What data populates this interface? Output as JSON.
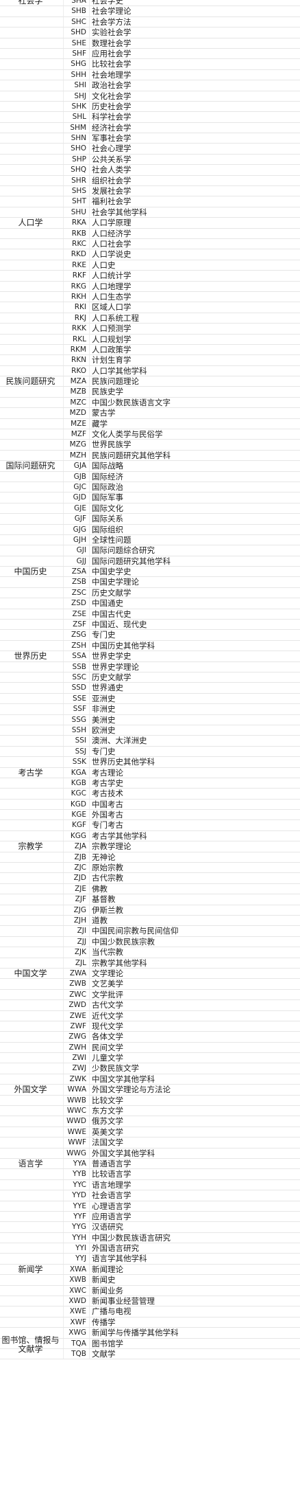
{
  "rows": [
    [
      "社会学",
      "SHA",
      "社会学史"
    ],
    [
      "",
      "SHB",
      "社会学理论"
    ],
    [
      "",
      "SHC",
      "社会学方法"
    ],
    [
      "",
      "SHD",
      "实验社会学"
    ],
    [
      "",
      "SHE",
      "数理社会学"
    ],
    [
      "",
      "SHF",
      "应用社会学"
    ],
    [
      "",
      "SHG",
      "比较社会学"
    ],
    [
      "",
      "SHH",
      "社会地理学"
    ],
    [
      "",
      "SHI",
      "政治社会学"
    ],
    [
      "",
      "SHJ",
      "文化社会学"
    ],
    [
      "",
      "SHK",
      "历史社会学"
    ],
    [
      "",
      "SHL",
      "科学社会学"
    ],
    [
      "",
      "SHM",
      "经济社会学"
    ],
    [
      "",
      "SHN",
      "军事社会学"
    ],
    [
      "",
      "SHO",
      "社会心理学"
    ],
    [
      "",
      "SHP",
      "公共关系学"
    ],
    [
      "",
      "SHQ",
      "社会人类学"
    ],
    [
      "",
      "SHR",
      "组织社会学"
    ],
    [
      "",
      "SHS",
      "发展社会学"
    ],
    [
      "",
      "SHT",
      "福利社会学"
    ],
    [
      "",
      "SHU",
      "社会学其他学科"
    ],
    [
      "人口学",
      "RKA",
      "人口学原理"
    ],
    [
      "",
      "RKB",
      "人口经济学"
    ],
    [
      "",
      "RKC",
      "人口社会学"
    ],
    [
      "",
      "RKD",
      "人口学说史"
    ],
    [
      "",
      "RKE",
      "人口史"
    ],
    [
      "",
      "RKF",
      "人口统计学"
    ],
    [
      "",
      "RKG",
      "人口地理学"
    ],
    [
      "",
      "RKH",
      "人口生态学"
    ],
    [
      "",
      "RKI",
      "区域人口学"
    ],
    [
      "",
      "RKJ",
      "人口系统工程"
    ],
    [
      "",
      "RKK",
      "人口预测学"
    ],
    [
      "",
      "RKL",
      "人口规划学"
    ],
    [
      "",
      "RKM",
      "人口政策学"
    ],
    [
      "",
      "RKN",
      "计划生育学"
    ],
    [
      "",
      "RKO",
      "人口学其他学科"
    ],
    [
      "民族问题研究",
      "MZA",
      "民族问题理论"
    ],
    [
      "",
      "MZB",
      "民族史学"
    ],
    [
      "",
      "MZC",
      "中国少数民族语言文字"
    ],
    [
      "",
      "MZD",
      "蒙古学"
    ],
    [
      "",
      "MZE",
      "藏学"
    ],
    [
      "",
      "MZF",
      "文化人类学与民俗学"
    ],
    [
      "",
      "MZG",
      "世界民族学"
    ],
    [
      "",
      "MZH",
      "民族问题研究其他学科"
    ],
    [
      "国际问题研究",
      "GJA",
      "国际战略"
    ],
    [
      "",
      "GJB",
      "国际经济"
    ],
    [
      "",
      "GJC",
      "国际政治"
    ],
    [
      "",
      "GJD",
      "国际军事"
    ],
    [
      "",
      "GJE",
      "国际文化"
    ],
    [
      "",
      "GJF",
      "国际关系"
    ],
    [
      "",
      "GJG",
      "国际组织"
    ],
    [
      "",
      "GJH",
      "全球性问题"
    ],
    [
      "",
      "GJI",
      "国际问题综合研究"
    ],
    [
      "",
      "GJJ",
      "国际问题研究其他学科"
    ],
    [
      "中国历史",
      "ZSA",
      "中国史学史"
    ],
    [
      "",
      "ZSB",
      "中国史学理论"
    ],
    [
      "",
      "ZSC",
      "历史文献学"
    ],
    [
      "",
      "ZSD",
      "中国通史"
    ],
    [
      "",
      "ZSE",
      "中国古代史"
    ],
    [
      "",
      "ZSF",
      "中国近、现代史"
    ],
    [
      "",
      "ZSG",
      "专门史"
    ],
    [
      "",
      "ZSH",
      "中国历史其他学科"
    ],
    [
      "世界历史",
      "SSA",
      "世界史学史"
    ],
    [
      "",
      "SSB",
      "世界史学理论"
    ],
    [
      "",
      "SSC",
      "历史文献学"
    ],
    [
      "",
      "SSD",
      "世界通史"
    ],
    [
      "",
      "SSE",
      "亚洲史"
    ],
    [
      "",
      "SSF",
      "非洲史"
    ],
    [
      "",
      "SSG",
      "美洲史"
    ],
    [
      "",
      "SSH",
      "欧洲史"
    ],
    [
      "",
      "SSI",
      "澳洲、大洋洲史"
    ],
    [
      "",
      "SSJ",
      "专门史"
    ],
    [
      "",
      "SSK",
      "世界历史其他学科"
    ],
    [
      "考古学",
      "KGA",
      "考古理论"
    ],
    [
      "",
      "KGB",
      "考古学史"
    ],
    [
      "",
      "KGC",
      "考古技术"
    ],
    [
      "",
      "KGD",
      "中国考古"
    ],
    [
      "",
      "KGE",
      "外国考古"
    ],
    [
      "",
      "KGF",
      "专门考古"
    ],
    [
      "",
      "KGG",
      "考古学其他学科"
    ],
    [
      "宗教学",
      "ZJA",
      "宗教学理论"
    ],
    [
      "",
      "ZJB",
      "无神论"
    ],
    [
      "",
      "ZJC",
      "原始宗教"
    ],
    [
      "",
      "ZJD",
      "古代宗教"
    ],
    [
      "",
      "ZJE",
      "佛教"
    ],
    [
      "",
      "ZJF",
      "基督教"
    ],
    [
      "",
      "ZJG",
      "伊斯兰教"
    ],
    [
      "",
      "ZJH",
      "道教"
    ],
    [
      "",
      "ZJI",
      "中国民间宗教与民间信仰"
    ],
    [
      "",
      "ZJJ",
      "中国少数民族宗教"
    ],
    [
      "",
      "ZJK",
      "当代宗教"
    ],
    [
      "",
      "ZJL",
      "宗教学其他学科"
    ],
    [
      "中国文学",
      "ZWA",
      "文学理论"
    ],
    [
      "",
      "ZWB",
      "文艺美学"
    ],
    [
      "",
      "ZWC",
      "文学批评"
    ],
    [
      "",
      "ZWD",
      "古代文学"
    ],
    [
      "",
      "ZWE",
      "近代文学"
    ],
    [
      "",
      "ZWF",
      "现代文学"
    ],
    [
      "",
      "ZWG",
      "各体文学"
    ],
    [
      "",
      "ZWH",
      "民间文学"
    ],
    [
      "",
      "ZWI",
      "儿童文学"
    ],
    [
      "",
      "ZWJ",
      "少数民族文学"
    ],
    [
      "",
      "ZWK",
      "中国文学其他学科"
    ],
    [
      "外国文学",
      "WWA",
      "外国文学理论与方法论"
    ],
    [
      "",
      "WWB",
      "比较文学"
    ],
    [
      "",
      "WWC",
      "东方文学"
    ],
    [
      "",
      "WWD",
      "俄苏文学"
    ],
    [
      "",
      "WWE",
      "英美文学"
    ],
    [
      "",
      "WWF",
      "法国文学"
    ],
    [
      "",
      "WWG",
      "外国文学其他学科"
    ],
    [
      "语言学",
      "YYA",
      "普通语言学"
    ],
    [
      "",
      "YYB",
      "比较语言学"
    ],
    [
      "",
      "YYC",
      "语言地理学"
    ],
    [
      "",
      "YYD",
      "社会语言学"
    ],
    [
      "",
      "YYE",
      "心理语言学"
    ],
    [
      "",
      "YYF",
      "应用语言学"
    ],
    [
      "",
      "YYG",
      "汉语研究"
    ],
    [
      "",
      "YYH",
      "中国少数民族语言研究"
    ],
    [
      "",
      "YYI",
      "外国语言研究"
    ],
    [
      "",
      "YYJ",
      "语言学其他学科"
    ],
    [
      "新闻学",
      "XWA",
      "新闻理论"
    ],
    [
      "",
      "XWB",
      "新闻史"
    ],
    [
      "",
      "XWC",
      "新闻业务"
    ],
    [
      "",
      "XWD",
      "新闻事业经营管理"
    ],
    [
      "",
      "XWE",
      "广播与电视"
    ],
    [
      "",
      "XWF",
      "传播学"
    ],
    [
      "",
      "XWG",
      "新闻学与传播学其他学科"
    ],
    [
      "图书馆、情报与文献学",
      "TQA",
      "图书馆学"
    ],
    [
      "",
      "TQB",
      "文献学"
    ]
  ],
  "group_heads": {
    "SHA": "社会学",
    "RKA": "人口学",
    "MZA": "民族问题研究",
    "GJA": "国际问题研究",
    "ZSA": "中国历史",
    "SSA": "世界历史",
    "KGA": "考古学",
    "ZJA": "宗教学",
    "ZWA": "中国文学",
    "WWA": "外国文学",
    "YYA": "语言学",
    "XWA": "新闻学",
    "TQA": "图书馆、情报与文献学"
  }
}
